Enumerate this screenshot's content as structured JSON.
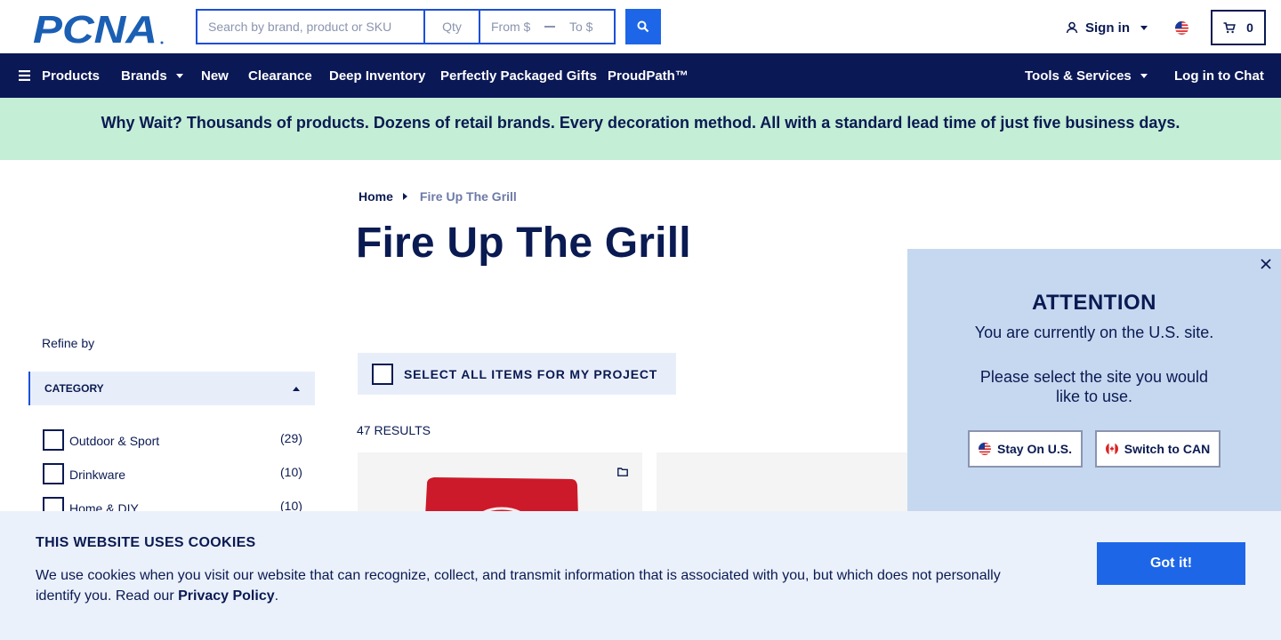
{
  "brand": {
    "logo_text": "PCNA"
  },
  "search": {
    "keyword_placeholder": "Search by brand, product or SKU",
    "qty_placeholder": "Qty",
    "price_from_placeholder": "From $",
    "price_to_placeholder": "To $"
  },
  "account": {
    "signin_label": "Sign in",
    "cart_count": "0"
  },
  "nav": {
    "products": "Products",
    "brands": "Brands",
    "new": "New",
    "clearance": "Clearance",
    "deep_inventory": "Deep Inventory",
    "gifts": "Perfectly Packaged Gifts",
    "proudpath": "ProudPath™",
    "tools": "Tools & Services",
    "chat": "Log in to Chat"
  },
  "promo": {
    "text": "Why Wait? Thousands of products. Dozens of retail brands. Every decoration method. All with a standard lead time of just five business days."
  },
  "breadcrumb": {
    "home": "Home",
    "current": "Fire Up The Grill"
  },
  "page": {
    "title": "Fire Up The Grill"
  },
  "sidebar": {
    "refine_label": "Refine by",
    "category_header": "CATEGORY",
    "filters": [
      {
        "label": "Outdoor & Sport",
        "count": "(29)"
      },
      {
        "label": "Drinkware",
        "count": "(10)"
      },
      {
        "label": "Home & DIY",
        "count": "(10)"
      }
    ]
  },
  "main": {
    "select_all_label": "SELECT ALL ITEMS FOR MY PROJECT",
    "results_label": "47 RESULTS"
  },
  "modal": {
    "title": "ATTENTION",
    "line1": "You are currently on the U.S. site.",
    "line2": "Please select the site you would like to use.",
    "stay_label": "Stay On U.S.",
    "switch_label": "Switch to CAN"
  },
  "cookie": {
    "title": "THIS WEBSITE USES COOKIES",
    "body": "We use cookies when you visit our website that can recognize, collect, and transmit information that is associated with you, but which does not personally identify you. Read our ",
    "link": "Privacy Policy",
    "end": ".",
    "button": "Got it!"
  },
  "colors": {
    "navy": "#0b1856",
    "accent_blue": "#1d66e8",
    "promo_green": "#c4eed5",
    "modal_blue": "#c6d8f0",
    "cookie_bg": "#ebf1fb"
  },
  "icons": [
    "search-icon",
    "user-icon",
    "us-flag-icon",
    "cart-icon",
    "hamburger-icon",
    "chevron-down-icon",
    "chevron-up-icon",
    "close-icon",
    "folder-icon",
    "canada-flag-icon"
  ]
}
